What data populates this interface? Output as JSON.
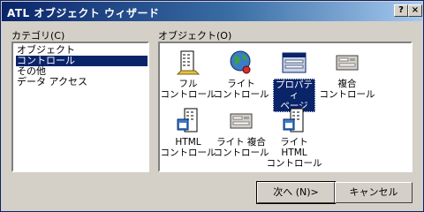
{
  "window": {
    "title": "ATL オブジェクト ウィザード",
    "help_label": "?",
    "close_label": "×"
  },
  "category": {
    "label": "カテゴリ(C)",
    "items": [
      {
        "label": "オブジェクト"
      },
      {
        "label": "コントロール",
        "selected": true
      },
      {
        "label": "その他"
      },
      {
        "label": "データ アクセス"
      }
    ]
  },
  "objects": {
    "label": "オブジェクト(O)",
    "items": [
      {
        "label": "フル\nコントロール",
        "icon": "full-control-icon"
      },
      {
        "label": "ライト\nコントロール",
        "icon": "lite-control-icon"
      },
      {
        "label": "プロパティ\nページ",
        "icon": "property-page-icon",
        "selected": true
      },
      {
        "label": "複合\nコントロール",
        "icon": "composite-control-icon"
      },
      {
        "label": "HTML\nコントロール",
        "icon": "html-control-icon"
      },
      {
        "label": "ライト 複合\nコントロール",
        "icon": "lite-composite-control-icon"
      },
      {
        "label": "ライト HTML\nコントロール",
        "icon": "lite-html-control-icon"
      }
    ]
  },
  "buttons": {
    "next": "次へ (N)>",
    "cancel": "キャンセル"
  },
  "colors": {
    "title_start": "#0a246a",
    "title_end": "#a6caf0",
    "selection": "#0a246a",
    "face": "#d4d0c8"
  }
}
